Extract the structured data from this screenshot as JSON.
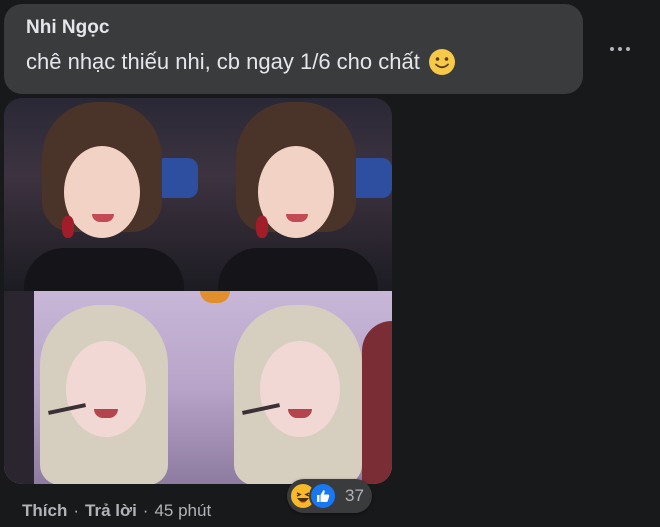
{
  "comment": {
    "author": "Nhi Ngọc",
    "text": "chê nhạc thiếu nhi, cb ngay 1/6 cho chất",
    "emoji": "slightly-smiling-face-icon"
  },
  "attachment": {
    "photos": [
      {
        "name": "photo-1"
      },
      {
        "name": "photo-2"
      },
      {
        "name": "photo-3"
      },
      {
        "name": "photo-4"
      }
    ]
  },
  "actions": {
    "like_label": "Thích",
    "separator": "·",
    "reply_label": "Trả lời",
    "time": "45 phút"
  },
  "reactions": {
    "types": [
      "haha-icon",
      "like-icon"
    ],
    "count": "37"
  },
  "colors": {
    "background": "#18191a",
    "bubble": "#3a3b3c",
    "text": "#e4e6eb",
    "secondary": "#b0b3b8",
    "like_blue": "#1877f2",
    "haha_yellow": "#f7b928"
  }
}
